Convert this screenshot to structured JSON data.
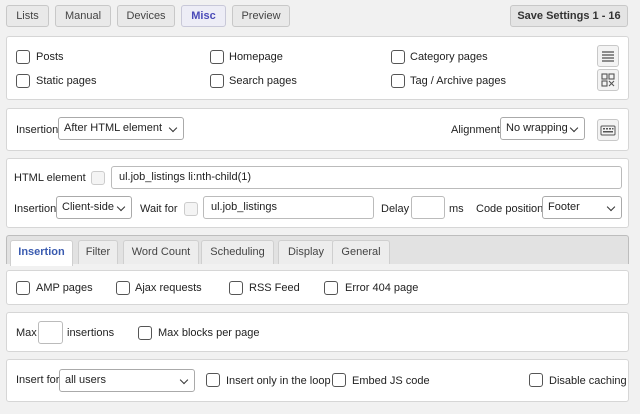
{
  "top_tabs": [
    {
      "label": "Lists"
    },
    {
      "label": "Manual"
    },
    {
      "label": "Devices"
    },
    {
      "label": "Misc"
    },
    {
      "label": "Preview"
    }
  ],
  "save_label": "Save Settings 1 - 16",
  "page_types": {
    "posts": "Posts",
    "homepage": "Homepage",
    "category_pages": "Category pages",
    "static_pages": "Static pages",
    "search_pages": "Search pages",
    "tag_archive_pages": "Tag / Archive pages"
  },
  "insertion_row": {
    "insertion_label": "Insertion",
    "insertion_value": "After HTML element",
    "alignment_label": "Alignment",
    "alignment_value": "No wrapping"
  },
  "html_element": {
    "label": "HTML element",
    "selector": "ul.job_listings li:nth-child(1)",
    "insertion_label": "Insertion",
    "insertion_value": "Client-side",
    "wait_for_label": "Wait for",
    "wait_for_value": "ul.job_listings",
    "delay_label": "Delay",
    "delay_value": "",
    "delay_unit": "ms",
    "code_position_label": "Code position",
    "code_position_value": "Footer"
  },
  "sub_tabs": [
    {
      "label": "Insertion"
    },
    {
      "label": "Filter"
    },
    {
      "label": "Word Count"
    },
    {
      "label": "Scheduling"
    },
    {
      "label": "Display"
    },
    {
      "label": "General"
    }
  ],
  "pages_row": {
    "amp": "AMP pages",
    "ajax": "Ajax requests",
    "rss": "RSS Feed",
    "error404": "Error 404 page"
  },
  "max_row": {
    "max_label": "Max",
    "max_value": "",
    "insertions_label": "insertions",
    "max_blocks_label": "Max blocks per page"
  },
  "insert_for_row": {
    "label": "Insert for",
    "value": "all users",
    "only_in_loop": "Insert only in the loop",
    "embed_js": "Embed JS code",
    "disable_caching": "Disable caching"
  }
}
